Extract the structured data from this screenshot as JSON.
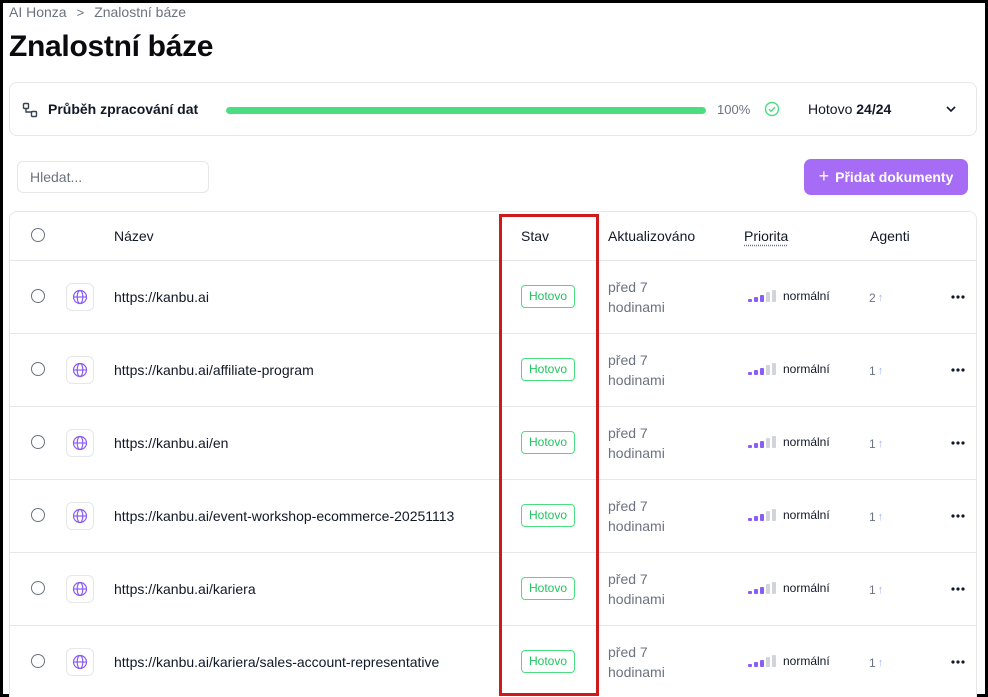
{
  "breadcrumb": {
    "items": [
      "AI Honza",
      "Znalostní báze"
    ],
    "separator": ">"
  },
  "page": {
    "title": "Znalostní báze"
  },
  "progress": {
    "label": "Průběh zpracování dat",
    "percent": 100,
    "percent_label": "100%",
    "status_prefix": "Hotovo",
    "status_count": "24/24",
    "bar_color": "#4ade80"
  },
  "search": {
    "placeholder": "Hledat...",
    "value": ""
  },
  "actions": {
    "add_documents": "Přidat dokumenty",
    "accent_color": "#a66cf6"
  },
  "table": {
    "columns": {
      "name": "Název",
      "status": "Stav",
      "updated": "Aktualizováno",
      "priority": "Priorita",
      "agents": "Agenti"
    },
    "rows": [
      {
        "name": "https://kanbu.ai",
        "status": "Hotovo",
        "updated_line1": "před 7",
        "updated_line2": "hodinami",
        "priority": "normální",
        "agents": "2"
      },
      {
        "name": "https://kanbu.ai/affiliate-program",
        "status": "Hotovo",
        "updated_line1": "před 7",
        "updated_line2": "hodinami",
        "priority": "normální",
        "agents": "1"
      },
      {
        "name": "https://kanbu.ai/en",
        "status": "Hotovo",
        "updated_line1": "před 7",
        "updated_line2": "hodinami",
        "priority": "normální",
        "agents": "1"
      },
      {
        "name": "https://kanbu.ai/event-workshop-ecommerce-20251113",
        "status": "Hotovo",
        "updated_line1": "před 7",
        "updated_line2": "hodinami",
        "priority": "normální",
        "agents": "1"
      },
      {
        "name": "https://kanbu.ai/kariera",
        "status": "Hotovo",
        "updated_line1": "před 7",
        "updated_line2": "hodinami",
        "priority": "normální",
        "agents": "1"
      },
      {
        "name": "https://kanbu.ai/kariera/sales-account-representative",
        "status": "Hotovo",
        "updated_line1": "před 7",
        "updated_line2": "hodinami",
        "priority": "normální",
        "agents": "1"
      }
    ]
  },
  "colors": {
    "status_green": "#22c55e",
    "highlight_red": "#d0191b",
    "priority_purple": "#8b5cf6"
  },
  "icons": {
    "progress": "nodes-icon",
    "check": "check-circle-icon",
    "chevron": "chevron-down-icon",
    "row": "globe-icon",
    "more": "more-horizontal-icon",
    "agents_arrow": "arrow-up-icon"
  }
}
